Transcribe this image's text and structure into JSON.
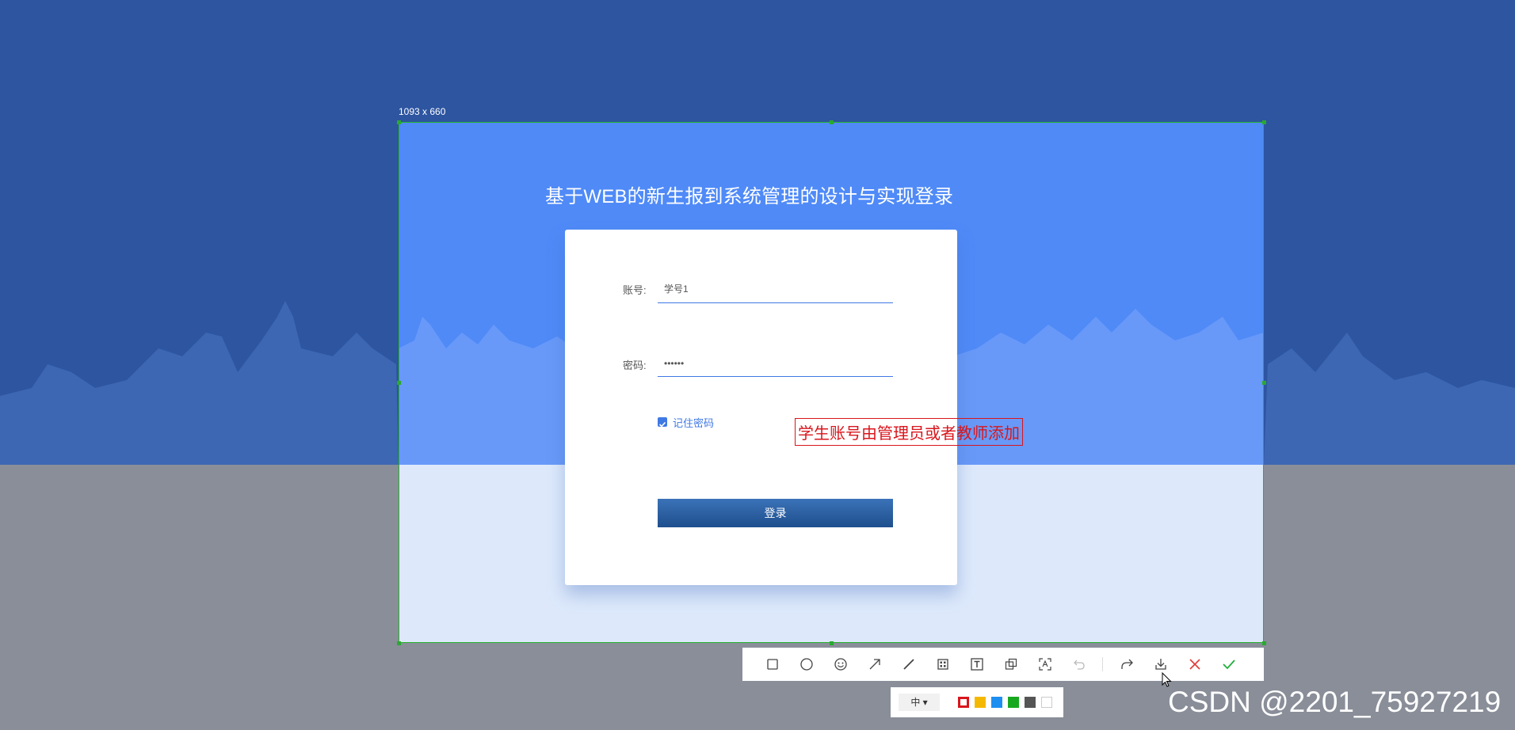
{
  "screenshot": {
    "size_label": "1093 x 660"
  },
  "login_page": {
    "title": "基于WEB的新生报到系统管理的设计与实现登录",
    "account_label": "账号:",
    "account_value": "学号1",
    "password_label": "密码:",
    "password_value": "••••••",
    "remember_label": "记住密码",
    "remember_checked": true,
    "login_button": "登录"
  },
  "annotation": {
    "text": "学生账号由管理员或者教师添加",
    "color": "#d8161c"
  },
  "toolbar": {
    "tools": [
      "rectangle-icon",
      "ellipse-icon",
      "emoji-icon",
      "arrow-icon",
      "line-icon",
      "mosaic-icon",
      "text-icon",
      "pin-icon",
      "ocr-icon",
      "undo-icon",
      "share-icon",
      "save-icon",
      "cancel-icon",
      "confirm-icon"
    ]
  },
  "subbar": {
    "size_selected": "中 ▾",
    "colors": [
      "#d8161c",
      "#f5b800",
      "#1e8ff0",
      "#18a81f",
      "#555555",
      "#ffffff"
    ]
  },
  "watermark": "CSDN @2201_75927219",
  "colors": {
    "selection_border": "#27b32d",
    "accent_blue": "#3f79e4",
    "page_blue": "#4f8af7"
  }
}
